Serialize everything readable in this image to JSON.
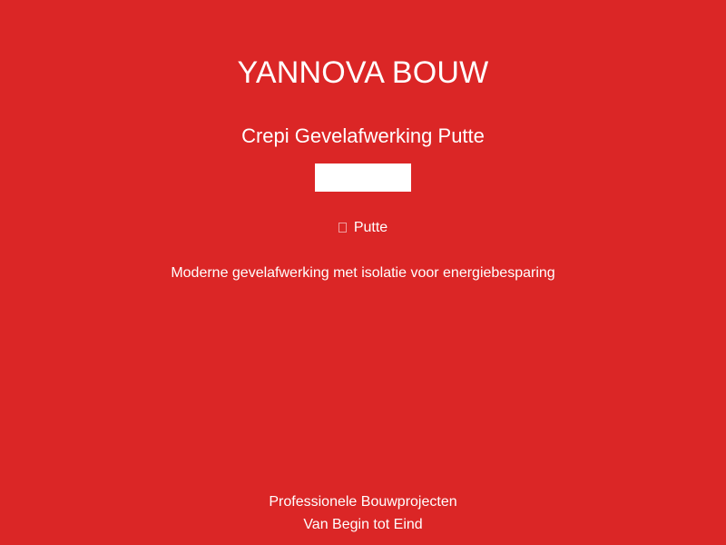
{
  "brand": {
    "name": "YANNOVA BOUW"
  },
  "hero": {
    "title": "Crepi Gevelafwerking Putte",
    "location_icon": "map-pin-icon",
    "location": "Putte",
    "description": "Moderne gevelafwerking met isolatie voor energiebesparing"
  },
  "footer": {
    "line1": "Professionele Bouwprojecten",
    "line2": "Van Begin tot Eind"
  },
  "colors": {
    "background": "#db2626",
    "text": "#ffffff"
  }
}
